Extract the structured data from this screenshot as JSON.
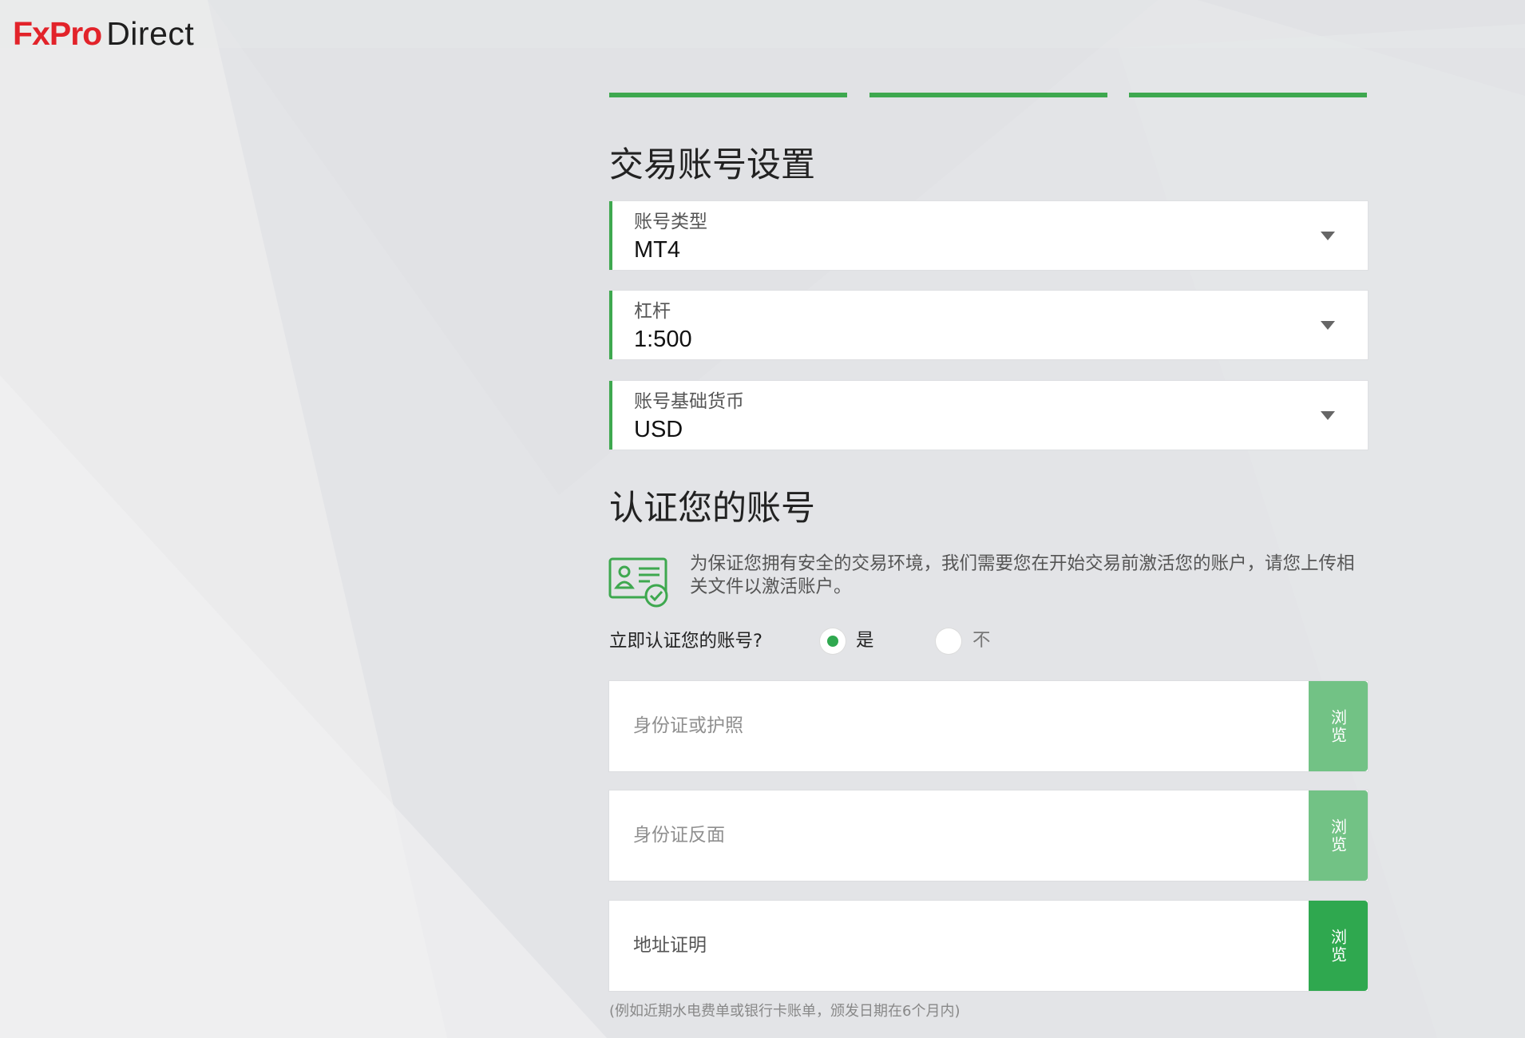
{
  "brand": {
    "logo_fx": "FxPro",
    "logo_direct": "Direct",
    "logo_fx_color": "#e2232a",
    "accent_color": "#3ea84f"
  },
  "steps": {
    "count": 3,
    "completed": 3
  },
  "account_setup": {
    "heading": "交易账号设置",
    "fields": [
      {
        "label": "账号类型",
        "value": "MT4"
      },
      {
        "label": "杠杆",
        "value": "1:500"
      },
      {
        "label": "账号基础货币",
        "value": "USD"
      }
    ]
  },
  "verification": {
    "heading": "认证您的账号",
    "icon": "id-card-check-icon",
    "notice": "为保证您拥有安全的交易环境，我们需要您在开始交易前激活您的账户，请您上传相关文件以激活账户。",
    "question": "立即认证您的账号?",
    "options": [
      {
        "label": "是",
        "selected": true
      },
      {
        "label": "不",
        "selected": false
      }
    ],
    "uploads": [
      {
        "placeholder": "身份证或护照",
        "browse": "浏览"
      },
      {
        "placeholder": "身份证反面",
        "browse": "浏览"
      },
      {
        "placeholder": "地址证明",
        "browse": "浏览"
      }
    ],
    "hint": "(例如近期水电费单或银行卡账单，颁发日期在6个月内)"
  }
}
